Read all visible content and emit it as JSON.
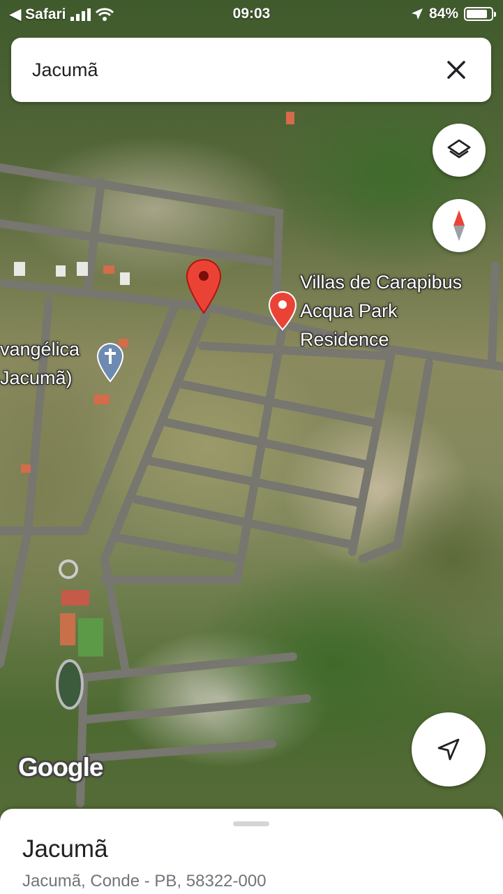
{
  "status_bar": {
    "back_app": "Safari",
    "time": "09:03",
    "battery": "84%",
    "battery_level": 0.84
  },
  "search": {
    "query": "Jacumã"
  },
  "map": {
    "labels": {
      "place_name": [
        "Villas de Carapibus",
        "Acqua Park",
        "Residence"
      ],
      "church_name": [
        "vangélica",
        "Jacumã)"
      ]
    },
    "attribution": "Google",
    "colors": {
      "pin_red": "#ea4335",
      "road": "#7a7a78"
    }
  },
  "place_sheet": {
    "title": "Jacumã",
    "address": "Jacumã, Conde - PB, 58322-000"
  }
}
